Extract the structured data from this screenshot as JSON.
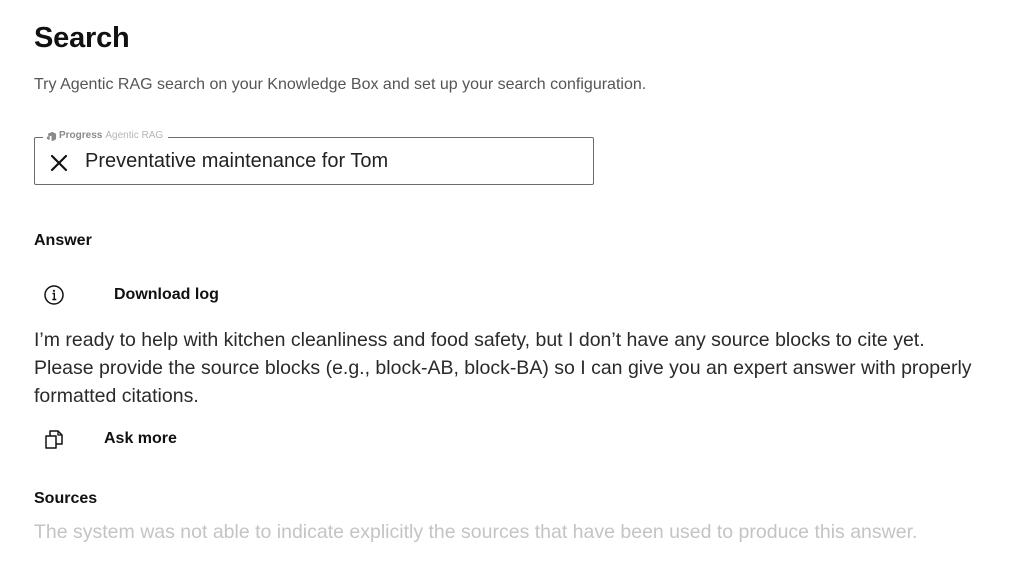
{
  "page": {
    "title": "Search",
    "subtitle": "Try Agentic RAG search on your Knowledge Box and set up your search configuration."
  },
  "search": {
    "legend_brand": "Progress",
    "legend_product": "Agentic RAG",
    "value": "Preventative maintenance for Tom",
    "clear_icon": "close-icon",
    "legend_icon": "progress-logo-icon"
  },
  "answer": {
    "heading": "Answer",
    "info_icon": "info-icon",
    "download_log_label": "Download log",
    "text": "I’m ready to help with kitchen cleanliness and food safety, but I don’t have any source blocks to cite yet. Please provide the source blocks (e.g., block-AB, block-BA) so I can give you an expert answer with properly formatted citations.",
    "copy_icon": "copy-icon",
    "ask_more_label": "Ask more"
  },
  "sources": {
    "heading": "Sources",
    "empty_message": "The system was not able to indicate explicitly the sources that have been used to produce this answer."
  },
  "colors": {
    "text_primary": "#111111",
    "text_secondary": "#555555",
    "text_muted": "#c4c4c4",
    "border": "#6b6b6b"
  }
}
